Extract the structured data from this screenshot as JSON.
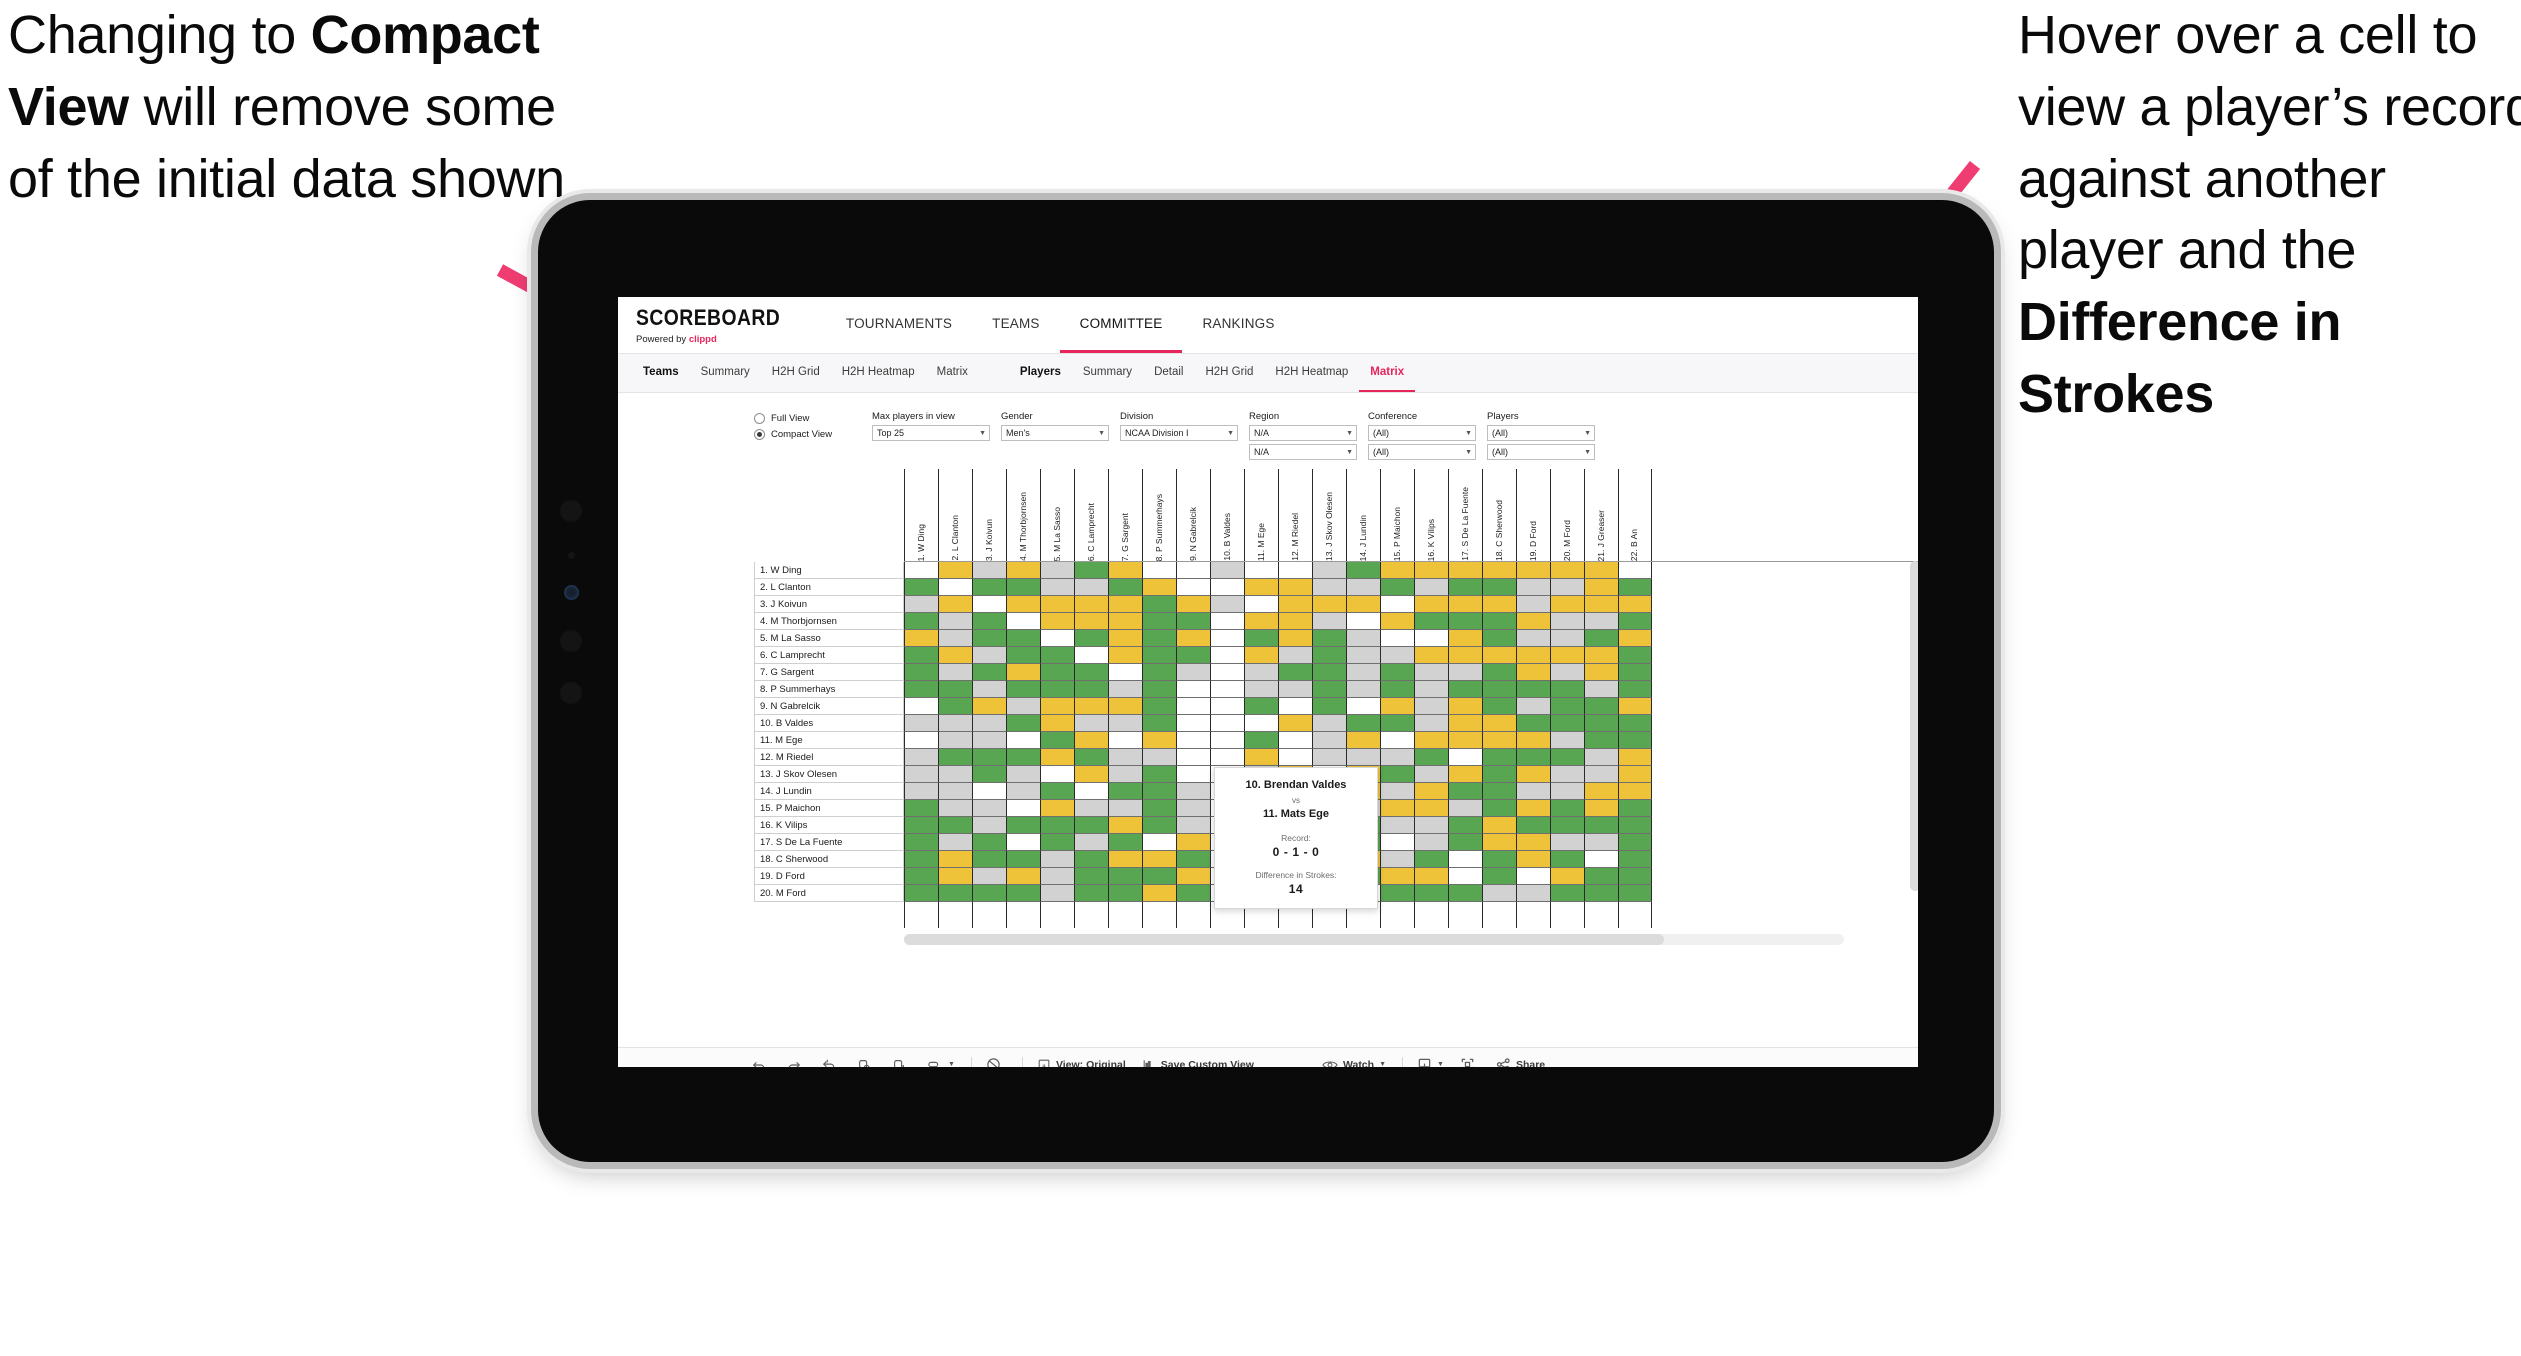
{
  "annotations": {
    "left": {
      "pre": "Changing to ",
      "bold": "Compact View",
      "post": " will remove some of the initial data shown"
    },
    "right": {
      "pre": "Hover over a cell to view a player’s record against another player and the ",
      "bold": "Difference in Strokes",
      "post": ""
    }
  },
  "colors": {
    "accent": "#e8245c",
    "win": "#58a651",
    "tie": "#eec33a",
    "loss": "#d2d2d2",
    "none": "#ffffff"
  },
  "app": {
    "logo": {
      "main": "SCOREBOARD",
      "sub_pre": "Powered by ",
      "sub_brand": "clippd"
    },
    "nav": [
      {
        "label": "TOURNAMENTS",
        "active": false
      },
      {
        "label": "TEAMS",
        "active": false
      },
      {
        "label": "COMMITTEE",
        "active": true
      },
      {
        "label": "RANKINGS",
        "active": false
      }
    ],
    "subnav_teams": [
      {
        "label": "Teams",
        "lead": true
      },
      {
        "label": "Summary"
      },
      {
        "label": "H2H Grid"
      },
      {
        "label": "H2H Heatmap"
      },
      {
        "label": "Matrix"
      }
    ],
    "subnav_players": [
      {
        "label": "Players",
        "lead": true
      },
      {
        "label": "Summary"
      },
      {
        "label": "Detail"
      },
      {
        "label": "H2H Grid"
      },
      {
        "label": "H2H Heatmap"
      },
      {
        "label": "Matrix",
        "active": true
      }
    ]
  },
  "filters": {
    "view_mode": {
      "full": "Full View",
      "compact": "Compact View",
      "selected": "Compact View"
    },
    "max_players": {
      "label": "Max players in view",
      "value": "Top 25"
    },
    "gender": {
      "label": "Gender",
      "value": "Men's"
    },
    "division": {
      "label": "Division",
      "value": "NCAA Division I"
    },
    "region": {
      "label": "Region",
      "value1": "N/A",
      "value2": "N/A"
    },
    "conference": {
      "label": "Conference",
      "value1": "(All)",
      "value2": "(All)"
    },
    "players": {
      "label": "Players",
      "value1": "(All)",
      "value2": "(All)"
    }
  },
  "matrix": {
    "row_labels": [
      "1. W Ding",
      "2. L Clanton",
      "3. J Koivun",
      "4. M Thorbjornsen",
      "5. M La Sasso",
      "6. C Lamprecht",
      "7. G Sargent",
      "8. P Summerhays",
      "9. N Gabrelcik",
      "10. B Valdes",
      "11. M Ege",
      "12. M Riedel",
      "13. J Skov Olesen",
      "14. J Lundin",
      "15. P Maichon",
      "16. K Vilips",
      "17. S De La Fuente",
      "18. C Sherwood",
      "19. D Ford",
      "20. M Ford"
    ],
    "col_labels": [
      "1. W Ding",
      "2. L Clanton",
      "3. J Koivun",
      "4. M Thorbjornsen",
      "5. M La Sasso",
      "6. C Lamprecht",
      "7. G Sargent",
      "8. P Summerhays",
      "9. N Gabrelcik",
      "10. B Valdes",
      "11. M Ege",
      "12. M Riedel",
      "13. J Skov Olesen",
      "14. J Lundin",
      "15. P Maichon",
      "16. K Vilips",
      "17. S De La Fuente",
      "18. C Sherwood",
      "19. D Ford",
      "20. M Ford",
      "21. J Greaser",
      "22. B An"
    ],
    "legend": {
      "g": "win",
      "y": "tie",
      "a": "loss",
      "w": "no record"
    },
    "cells": [
      "wyayagyw aw agyyyyyyy",
      "gwggaagyw yyaagaggaayg",
      "aywyyyygya yyywyyyayyy",
      "gagwyyygg yyawygggyaag",
      "yaggwgygy gygawwygaagy",
      "gyaggwygg yagaayyyyyyg",
      "gagyggwga aggagaagyayg",
      "ggagggagw aagagaggggag",
      "wgyayyygw gwgwyaygaggy",
      "aaagyaagw wyaggayygggg",
      "waawgywyw gwaywyyyyagg",
      "agggygaaw ywaaagwgggay",
      "aagawyagw aywygaygyaay",
      "aawagwgga yagyayggaayy",
      "gaawyaaga wygayyagygyg",
      "ggagggyga wwggaagygggg",
      "gagwgagwy gwygwagyyaag",
      "gyggagyyg yyayagwgygwg",
      "gyayagggy gwggyywgwygg",
      "ggggaggyg gyawgggaaggg"
    ]
  },
  "tooltip": {
    "player_a": "10. Brendan Valdes",
    "vs": "vs",
    "player_b": "11. Mats Ege",
    "record_label": "Record:",
    "record_value": "0 - 1 - 0",
    "strokes_label": "Difference in Strokes:",
    "strokes_value": "14"
  },
  "toolbar": {
    "view_label": "View: Original",
    "save_label": "Save Custom View",
    "watch_label": "Watch",
    "share_label": "Share"
  }
}
